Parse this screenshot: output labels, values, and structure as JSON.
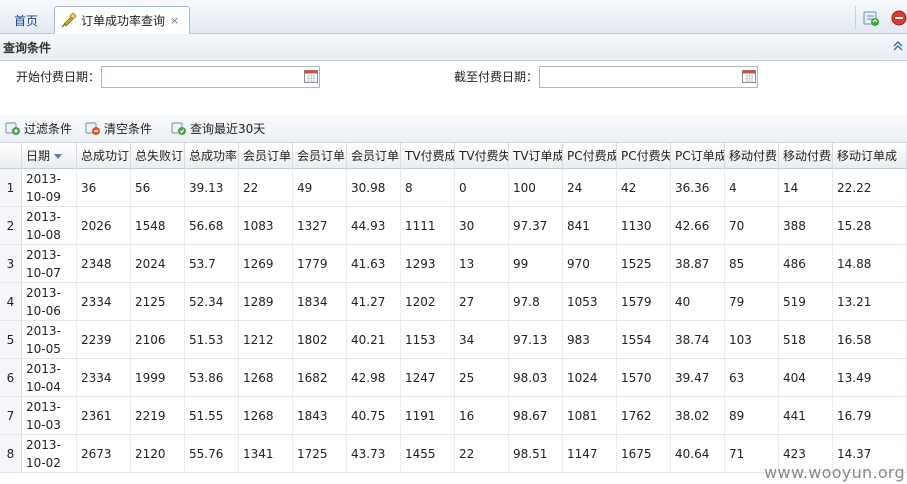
{
  "tabs": {
    "home_label": "首页",
    "active_label": "订单成功率查询",
    "close_glyph": "×"
  },
  "query_panel": {
    "title": "查询条件",
    "start_label": "开始付费日期：",
    "end_label": "截至付费日期：",
    "start_value": "",
    "end_value": ""
  },
  "toolbar": {
    "filter_label": "过滤条件",
    "clear_label": "清空条件",
    "recent_label": "查询最近30天"
  },
  "grid": {
    "columns": [
      "日期",
      "总成功订",
      "总失败订",
      "总成功率",
      "会员订单",
      "会员订单",
      "会员订单",
      "TV付费成",
      "TV付费失",
      "TV订单成",
      "PC付费成",
      "PC付费失",
      "PC订单成",
      "移动付费",
      "移动付费",
      "移动订单成"
    ],
    "sorted_column": "日期",
    "rows": [
      [
        "1",
        "2013-10-09",
        "36",
        "56",
        "39.13",
        "22",
        "49",
        "30.98",
        "8",
        "0",
        "100",
        "24",
        "42",
        "36.36",
        "4",
        "14",
        "22.22"
      ],
      [
        "2",
        "2013-10-08",
        "2026",
        "1548",
        "56.68",
        "1083",
        "1327",
        "44.93",
        "1111",
        "30",
        "97.37",
        "841",
        "1130",
        "42.66",
        "70",
        "388",
        "15.28"
      ],
      [
        "3",
        "2013-10-07",
        "2348",
        "2024",
        "53.7",
        "1269",
        "1779",
        "41.63",
        "1293",
        "13",
        "99",
        "970",
        "1525",
        "38.87",
        "85",
        "486",
        "14.88"
      ],
      [
        "4",
        "2013-10-06",
        "2334",
        "2125",
        "52.34",
        "1289",
        "1834",
        "41.27",
        "1202",
        "27",
        "97.8",
        "1053",
        "1579",
        "40",
        "79",
        "519",
        "13.21"
      ],
      [
        "5",
        "2013-10-05",
        "2239",
        "2106",
        "51.53",
        "1212",
        "1802",
        "40.21",
        "1153",
        "34",
        "97.13",
        "983",
        "1554",
        "38.74",
        "103",
        "518",
        "16.58"
      ],
      [
        "6",
        "2013-10-04",
        "2334",
        "1999",
        "53.86",
        "1268",
        "1682",
        "42.98",
        "1247",
        "25",
        "98.03",
        "1024",
        "1570",
        "39.47",
        "63",
        "404",
        "13.49"
      ],
      [
        "7",
        "2013-10-03",
        "2361",
        "2219",
        "51.55",
        "1268",
        "1843",
        "40.75",
        "1191",
        "16",
        "98.67",
        "1081",
        "1762",
        "38.02",
        "89",
        "441",
        "16.79"
      ],
      [
        "8",
        "2013-10-02",
        "2673",
        "2120",
        "55.76",
        "1341",
        "1725",
        "43.73",
        "1455",
        "22",
        "98.51",
        "1147",
        "1675",
        "40.64",
        "71",
        "423",
        "14.37"
      ]
    ]
  },
  "watermark": "www.wooyun.org",
  "colors": {
    "accent": "#15428b",
    "header_bg": "#e3e9f1",
    "border": "#99bbe8"
  }
}
